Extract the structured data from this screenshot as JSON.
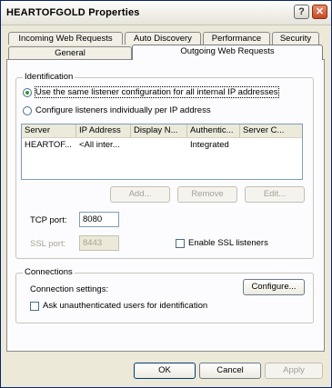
{
  "window": {
    "title": "HEARTOFGOLD Properties",
    "help_label": "?",
    "close_label": "✕"
  },
  "tabs_back": [
    "Incoming Web Requests",
    "Auto Discovery",
    "Performance",
    "Security"
  ],
  "tabs_front": [
    "General",
    "Outgoing Web Requests"
  ],
  "identification": {
    "legend": "Identification",
    "radio_same": "Use the same listener configuration for all internal IP addresses",
    "radio_individual": "Configure listeners individually per IP address",
    "columns": [
      "Server",
      "IP Address",
      "Display N...",
      "Authentic...",
      "Server C..."
    ],
    "rows": [
      {
        "server": "HEARTOF...",
        "ip": "<All inter...",
        "display": "",
        "auth": "Integrated",
        "servercert": ""
      }
    ],
    "add_label": "Add...",
    "remove_label": "Remove",
    "edit_label": "Edit...",
    "tcp_label": "TCP port:",
    "tcp_value": "8080",
    "ssl_label": "SSL port:",
    "ssl_value": "8443",
    "enable_ssl": "Enable SSL listeners"
  },
  "connections": {
    "legend": "Connections",
    "settings_label": "Connection settings:",
    "configure_label": "Configure...",
    "ask_auth": "Ask unauthenticated users for identification"
  },
  "footer": {
    "ok": "OK",
    "cancel": "Cancel",
    "apply": "Apply"
  }
}
